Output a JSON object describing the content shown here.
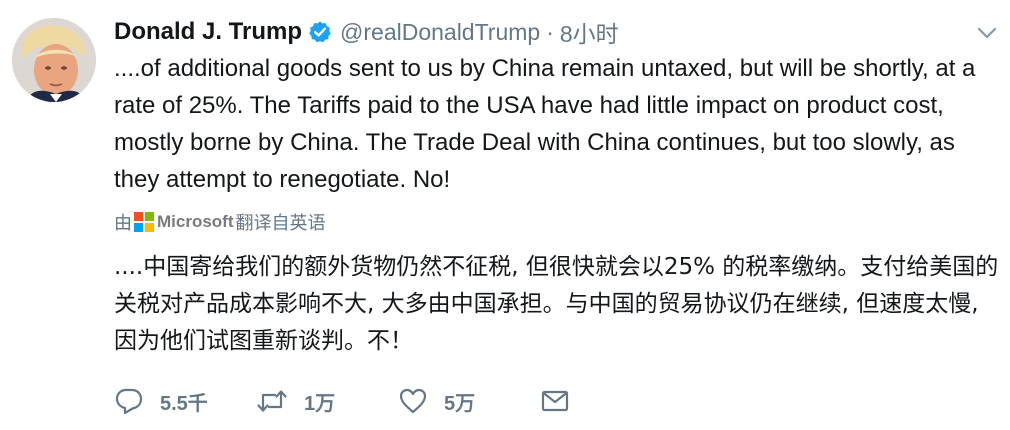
{
  "user": {
    "display_name": "Donald J. Trump",
    "handle": "@realDonaldTrump",
    "separator": "·",
    "time": "8小时"
  },
  "tweet": {
    "text": "....of additional goods sent to us by China remain untaxed, but will be shortly, at a rate of 25%. The Tariffs paid to the USA have had little impact on product cost, mostly borne by China. The Trade Deal with China continues, but too slowly, as they attempt to renegotiate. No!"
  },
  "translation": {
    "prefix": "由",
    "provider": "Microsoft",
    "suffix": "翻译自英语",
    "text": "....中国寄给我们的额外货物仍然不征税, 但很快就会以25% 的税率缴纳。支付给美国的关税对产品成本影响不大, 大多由中国承担。与中国的贸易协议仍在继续, 但速度太慢, 因为他们试图重新谈判。不！"
  },
  "actions": {
    "reply_count": "5.5千",
    "retweet_count": "1万",
    "like_count": "5万"
  },
  "colors": {
    "verified_blue": "#1da1f2",
    "muted_gray": "#657786",
    "text_dark": "#14171a",
    "ms_red": "#f25022",
    "ms_green": "#7fba00",
    "ms_blue": "#00a4ef",
    "ms_yellow": "#ffb900"
  },
  "icons": {
    "verified": "verified-badge-icon",
    "caret": "chevron-down-icon",
    "reply": "reply-icon",
    "retweet": "retweet-icon",
    "like": "heart-icon",
    "message": "envelope-icon"
  }
}
